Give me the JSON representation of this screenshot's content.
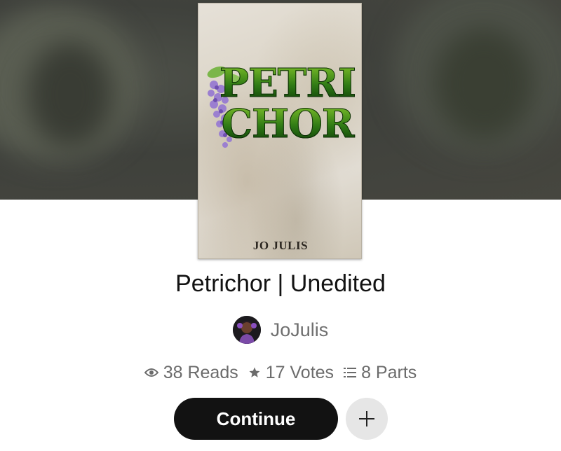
{
  "story": {
    "cover": {
      "title_line1": "PETRI",
      "title_line2": "CHOR",
      "author": "JO JULIS"
    },
    "title": "Petrichor | Unedited",
    "author": "JoJulis",
    "stats": {
      "reads": "38 Reads",
      "votes": "17 Votes",
      "parts": "8 Parts"
    }
  },
  "actions": {
    "continue_label": "Continue"
  },
  "icons": {
    "reads": "eye-icon",
    "votes": "star-icon",
    "parts": "list-icon",
    "add": "plus-icon"
  },
  "colors": {
    "primary_button": "#121212",
    "secondary_button": "#e6e6e6",
    "muted_text": "#6b6b6b"
  }
}
